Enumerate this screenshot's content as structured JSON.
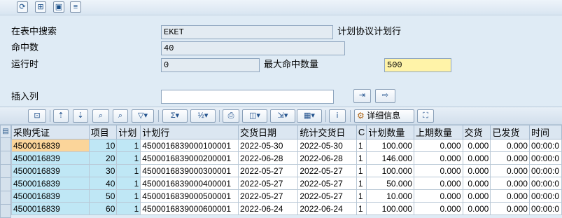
{
  "toolbar_icons": [
    "refresh-icon",
    "hierarchy-icon",
    "save-icon",
    "document-icon"
  ],
  "form": {
    "search_table_label": "在表中搜索",
    "search_table_value": "EKET",
    "search_table_desc": "计划协议计划行",
    "hits_label": "命中数",
    "hits_value": "40",
    "runtime_label": "运行时",
    "runtime_value": "0",
    "max_hits_label": "最大命中数量",
    "max_hits_value": "500",
    "insert_col_label": "插入列",
    "insert_col_value": ""
  },
  "grid_toolbar": {
    "details_label": "详细信息"
  },
  "table": {
    "headers": [
      "采购凭证",
      "项目",
      "计划",
      "计划行",
      "交货日期",
      "统计交货日",
      "C",
      "计划数量",
      "上期数量",
      "交货",
      "已发货",
      "时间"
    ],
    "rows": [
      [
        "4500016839",
        "10",
        "1",
        "450001683900010000​1",
        "2022-05-30",
        "2022-05-30",
        "1",
        "100.000",
        "0.000",
        "0.000",
        "0.000",
        "00:00:0"
      ],
      [
        "4500016839",
        "20",
        "1",
        "4500016839000200001",
        "2022-06-28",
        "2022-06-28",
        "1",
        "146.000",
        "0.000",
        "0.000",
        "0.000",
        "00:00:0"
      ],
      [
        "4500016839",
        "30",
        "1",
        "4500016839000300001",
        "2022-05-27",
        "2022-05-27",
        "1",
        "100.000",
        "0.000",
        "0.000",
        "0.000",
        "00:00:0"
      ],
      [
        "4500016839",
        "40",
        "1",
        "4500016839000400001",
        "2022-05-27",
        "2022-05-27",
        "1",
        "50.000",
        "0.000",
        "0.000",
        "0.000",
        "00:00:0"
      ],
      [
        "4500016839",
        "50",
        "1",
        "4500016839000500001",
        "2022-05-27",
        "2022-05-27",
        "1",
        "10.000",
        "0.000",
        "0.000",
        "0.000",
        "00:00:0"
      ],
      [
        "4500016839",
        "60",
        "1",
        "4500016839000600001",
        "2022-06-24",
        "2022-06-24",
        "1",
        "100.000",
        "0.000",
        "0.000",
        "0.000",
        "00:00:0"
      ]
    ]
  },
  "colors": {
    "key_column": "#bfe7f5",
    "selected_cell": "#fbd59a",
    "max_hits_field": "#fff3a8"
  }
}
